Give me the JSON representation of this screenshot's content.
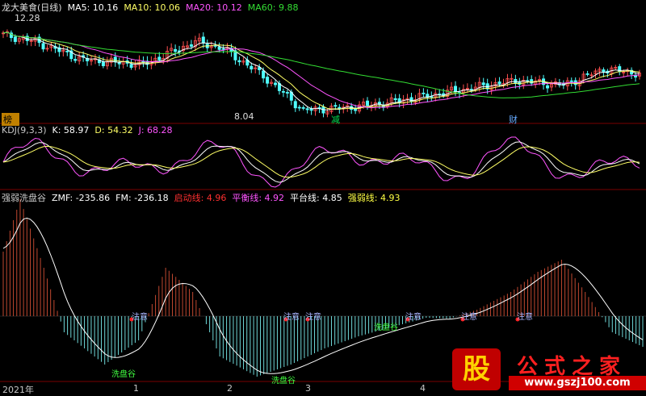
{
  "main": {
    "stock_name": "龙大美食(日线)",
    "ma_labels": [
      {
        "text": "MA5: 10.16",
        "color": "#ffffff"
      },
      {
        "text": "MA10: 10.06",
        "color": "#ffff66"
      },
      {
        "text": "MA20: 10.12",
        "color": "#ff55ff"
      },
      {
        "text": "MA60: 9.88",
        "color": "#33dd33"
      }
    ],
    "high_label": "12.28",
    "low_label": "8.04",
    "event_markers": [
      "榜",
      "减",
      "财"
    ]
  },
  "kdj": {
    "title": "KDJ(9,3,3)",
    "k": "K: 58.97",
    "d": "D: 54.32",
    "j": "J: 68.28"
  },
  "osc": {
    "title": "强弱洗盘谷",
    "zmf": "ZMF: -235.86",
    "fm": "FM: -236.18",
    "qidong": "启动线: 4.96",
    "pingheng": "平衡线: 4.92",
    "pingtai": "平台线: 4.85",
    "qiangruo": "强弱线: 4.93",
    "annot_notice": "注意",
    "annot_xipan": "洗盘谷"
  },
  "xaxis": {
    "year": "2021年",
    "ticks": [
      "1",
      "2",
      "3",
      "4"
    ]
  },
  "watermark": {
    "logo": "股",
    "title": "公式之家",
    "url": "www.gszj100.com"
  },
  "colors": {
    "up": "#ff5050",
    "down": "#50ffff",
    "ma5": "#ffffff",
    "ma10": "#ffff66",
    "ma20": "#ff55ff",
    "ma60": "#33dd33",
    "grid": "#7a0000"
  }
}
